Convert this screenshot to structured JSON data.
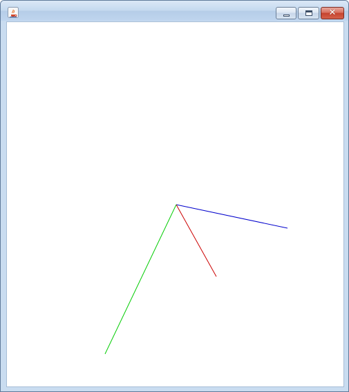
{
  "window": {
    "title": "",
    "icon": "java-cup-icon",
    "buttons": [
      "minimize-icon",
      "maximize-icon",
      "close-icon"
    ],
    "close_color": "#c5432f"
  },
  "canvas": {
    "background": "#ffffff",
    "line_colors": {
      "red": "#cc0000",
      "green": "#00cc00",
      "blue": "#0000cc"
    }
  }
}
